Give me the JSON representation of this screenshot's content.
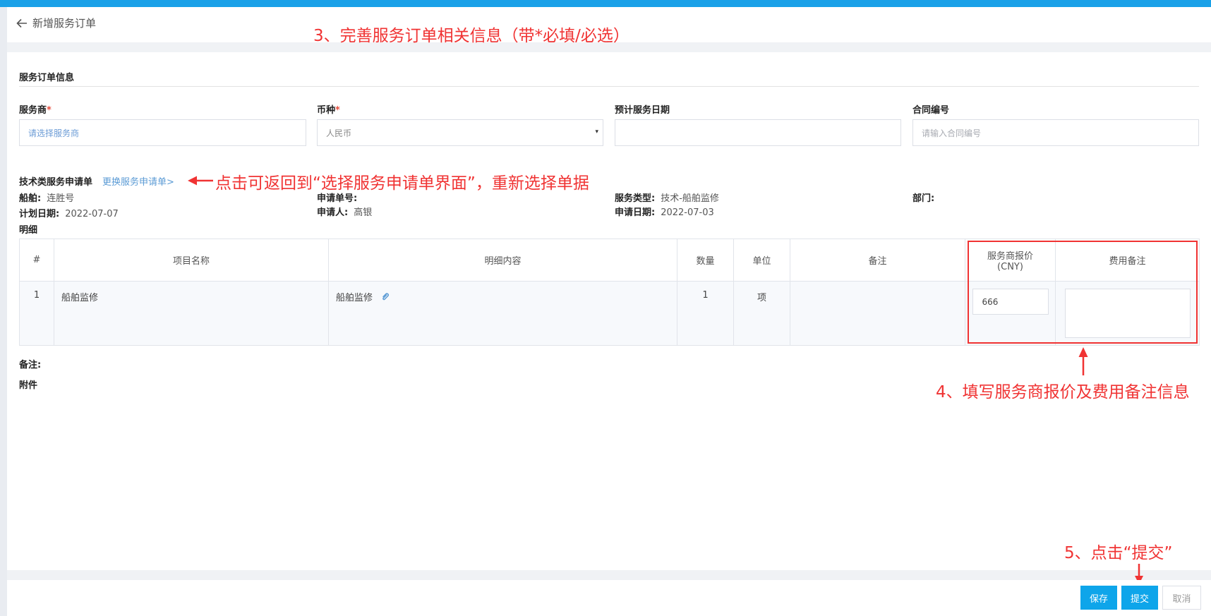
{
  "header": {
    "back_label": "新增服务订单"
  },
  "annotations": {
    "step3": "3、完善服务订单相关信息（带*必填/必选）",
    "change_tip": "点击可返回到“选择服务申请单界面”，重新选择单据",
    "step4": "4、填写服务商报价及费用备注信息",
    "step5": "5、点击“提交”"
  },
  "form": {
    "section_title": "服务订单信息",
    "supplier": {
      "label": "服务商",
      "required_mark": "*",
      "placeholder": "请选择服务商"
    },
    "currency": {
      "label": "币种",
      "required_mark": "*",
      "value": "人民币",
      "arrow": "▾"
    },
    "service_date": {
      "label": "预计服务日期",
      "value": ""
    },
    "contract_no": {
      "label": "合同编号",
      "placeholder": "请输入合同编号"
    }
  },
  "request": {
    "title": "技术类服务申请单",
    "change_link": "更换服务申请单>",
    "ship_label": "船舶:",
    "ship_value": "连胜号",
    "request_no_label": "申请单号:",
    "request_no_value": "",
    "service_type_label": "服务类型:",
    "service_type_value": "技术-船舶监修",
    "department_label": "部门:",
    "department_value": "",
    "plan_date_label": "计划日期:",
    "plan_date_value": "2022-07-07",
    "applicant_label": "申请人:",
    "applicant_value": "高银",
    "apply_date_label": "申请日期:",
    "apply_date_value": "2022-07-03"
  },
  "detail": {
    "title": "明细",
    "columns": {
      "index": "#",
      "item_name": "项目名称",
      "content": "明细内容",
      "qty": "数量",
      "unit": "单位",
      "remark": "备注",
      "quote_line1": "服务商报价",
      "quote_line2": "(CNY)",
      "fee_remark": "费用备注"
    },
    "rows": [
      {
        "index": "1",
        "item_name": "船舶监修",
        "content": "船舶监修",
        "qty": "1",
        "unit": "项",
        "remark": "",
        "quote": "666",
        "fee_remark": ""
      }
    ]
  },
  "extras": {
    "remark_label": "备注:",
    "attachment_label": "附件"
  },
  "footer": {
    "save": "保存",
    "submit": "提交",
    "cancel": "取消"
  },
  "colors": {
    "brand": "#1aa1e8",
    "button": "#0ea5ea",
    "annotation": "#f03333",
    "link": "#5b9bd5"
  }
}
